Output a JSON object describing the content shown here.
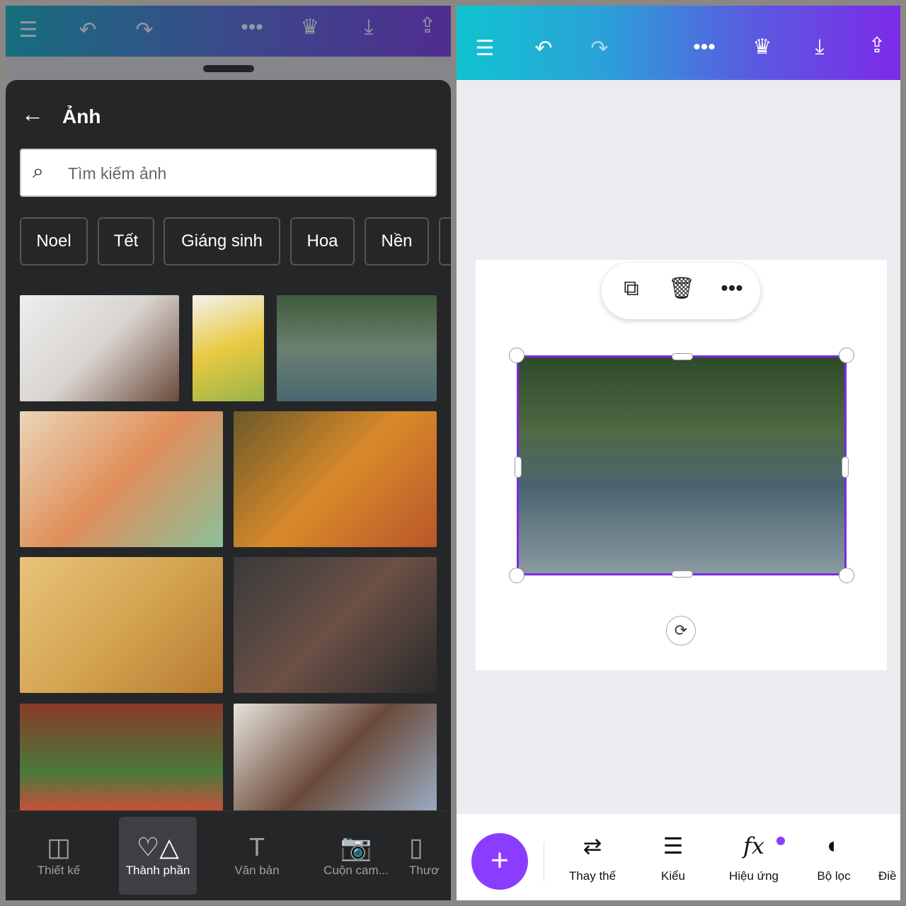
{
  "left": {
    "toolbar": {
      "icons": [
        "menu-icon",
        "undo-icon",
        "redo-icon",
        "more-icon",
        "crown-icon",
        "download-icon",
        "share-icon"
      ]
    },
    "panel": {
      "title": "Ảnh",
      "search_placeholder": "Tìm kiếm ảnh",
      "chips": [
        "Noel",
        "Tết",
        "Giáng sinh",
        "Hoa",
        "Nền"
      ]
    },
    "photos": [
      "Women with protest signs",
      "Corn and avocado on grid",
      "Couple in car with gifts",
      "Picnic food on floral cloth",
      "Kids lying on blanket with tablet",
      "Wine glasses and bottles",
      "Hands holding together",
      "Children in garden",
      "Woman with flowers"
    ],
    "bottom_nav": [
      {
        "label": "Thiết kế"
      },
      {
        "label": "Thành phần",
        "active": true
      },
      {
        "label": "Văn bản"
      },
      {
        "label": "Cuộn cam..."
      },
      {
        "label": "Thươ"
      }
    ]
  },
  "right": {
    "toolbar": {
      "icons": [
        "menu-icon",
        "undo-icon",
        "redo-icon",
        "more-icon",
        "crown-icon",
        "download-icon",
        "share-icon"
      ]
    },
    "selected_image": "Couple in car with gifts",
    "bottom_tools": [
      {
        "label": "Thay thế"
      },
      {
        "label": "Kiểu"
      },
      {
        "label": "Hiệu ứng",
        "badge": true
      },
      {
        "label": "Bộ lọc"
      },
      {
        "label": "Điề"
      }
    ],
    "accent": "#8b3dff"
  }
}
